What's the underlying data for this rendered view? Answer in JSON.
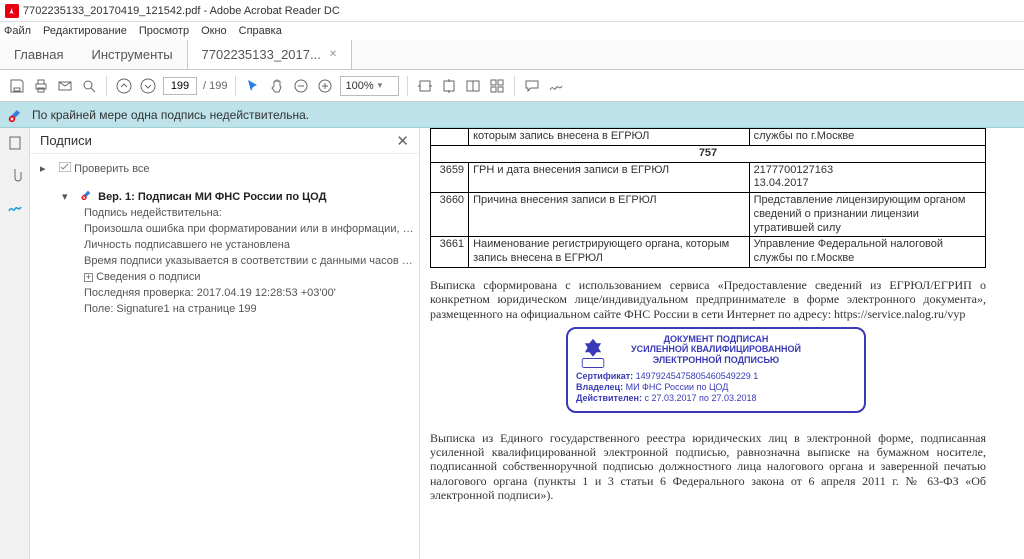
{
  "titlebar": {
    "text": "7702235133_20170419_121542.pdf - Adobe Acrobat Reader DC"
  },
  "menubar": {
    "file": "Файл",
    "edit": "Редактирование",
    "view": "Просмотр",
    "window": "Окно",
    "help": "Справка"
  },
  "tabs": {
    "home": "Главная",
    "tools": "Инструменты",
    "doc": "7702235133_2017..."
  },
  "toolbar": {
    "page_cur": "199",
    "page_total": "/  199",
    "zoom": "100%"
  },
  "alert": {
    "text": "По крайней мере одна подпись недействительна."
  },
  "panel": {
    "title": "Подписи",
    "verify_all": "Проверить все",
    "ver_line": "Вер. 1: Подписан МИ ФНС России по ЦОД",
    "invalid": "Подпись недействительна:",
    "err1": "Произошла ошибка при форматировании или в информации, содержаще",
    "err2": "Личность подписавшего не установлена",
    "err3": "Время подписи указывается в соответствии с данными часов на компьютер",
    "details": "Сведения о подписи",
    "last_check": "Последняя проверка: 2017.04.19 12:28:53 +03'00'",
    "field": "Поле: Signature1 на странице 199"
  },
  "doc": {
    "row_top_mid": "которым запись внесена в ЕГРЮЛ",
    "row_top_right": "службы по г.Москве",
    "section": "757",
    "rows": [
      {
        "n": "3659",
        "mid": "ГРН и дата внесения записи в ЕГРЮЛ",
        "right": "2177700127163\n13.04.2017"
      },
      {
        "n": "3660",
        "mid": "Причина внесения записи в ЕГРЮЛ",
        "right": "Представление лицензирующим органом сведений о признании лицензии утратившей силу"
      },
      {
        "n": "3661",
        "mid": "Наименование регистрирующего органа, которым запись внесена в ЕГРЮЛ",
        "right": "Управление Федеральной налоговой службы по г.Москве"
      }
    ],
    "para1": "Выписка сформирована с использованием сервиса «Предоставление сведений из ЕГРЮЛ/ЕГРИП о конкретном юридическом лице/индивидуальном предпринимателе в форме электронного документа», размещенного на официальном сайте ФНС России в сети Интернет по адресу: https://service.nalog.ru/vyp",
    "stamp": {
      "h1": "ДОКУМЕНТ ПОДПИСАН",
      "h2": "УСИЛЕННОЙ КВАЛИФИЦИРОВАННОЙ",
      "h3": "ЭЛЕКТРОННОЙ ПОДПИСЬЮ",
      "cert_l": "Сертификат:",
      "cert_v": "14979245475805460549229 1",
      "owner_l": "Владелец:",
      "owner_v": "МИ ФНС России по ЦОД",
      "valid_l": "Действителен:",
      "valid_v": "с 27.03.2017 по 27.03.2018"
    },
    "para2": "Выписка из Единого государственного реестра юридических лиц в электронной форме, подписанная усиленной квалифицированной электронной подписью, равнозначна выписке на бумажном носителе, подписанной собственноручной подписью должностного лица налогового органа и заверенной печатью налогового органа (пункты 1 и 3 статьи 6 Федерального закона от 6 апреля 2011 г. № 63-ФЗ «Об электронной подписи»)."
  }
}
